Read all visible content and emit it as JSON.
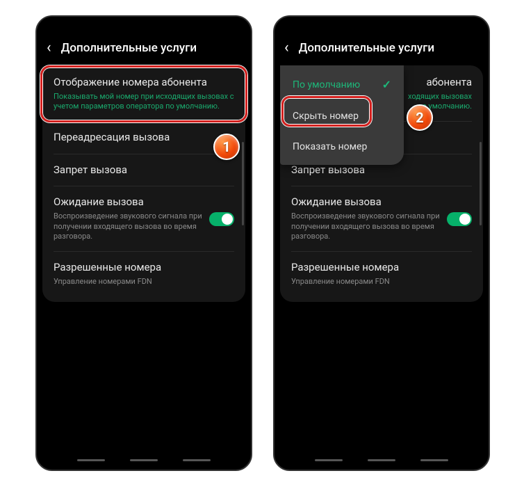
{
  "header_title": "Дополнительные услуги",
  "settings": {
    "caller_id": {
      "title": "Отображение номера абонента",
      "desc": "Показывать мой номер при исходящих вызовах с учетом параметров оператора по умолчанию."
    },
    "forwarding": {
      "title": "Переадресация вызова"
    },
    "barring": {
      "title": "Запрет вызова"
    },
    "waiting": {
      "title": "Ожидание вызова",
      "desc": "Воспроизведение звукового сигнала при получении входящего вызова во время разговора."
    },
    "fdn": {
      "title": "Разрешенные номера",
      "desc": "Управление номерами FDN"
    }
  },
  "popup": {
    "option_default": "По умолчанию",
    "option_hide": "Скрыть номер",
    "option_show": "Показать номер"
  },
  "right_peek": {
    "caller_id_tail": "абонента",
    "desc_tail1": "ходящих вызовах",
    "desc_tail2": "по умолчанию."
  },
  "badges": {
    "one": "1",
    "two": "2"
  }
}
